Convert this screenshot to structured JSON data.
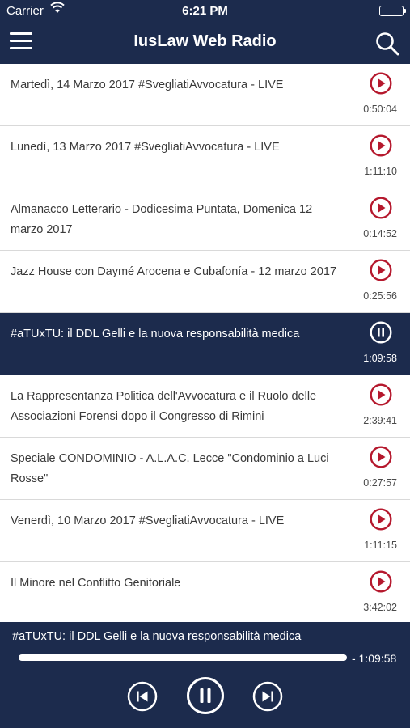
{
  "status": {
    "carrier": "Carrier",
    "time": "6:21 PM"
  },
  "nav": {
    "title": "IusLaw Web Radio"
  },
  "episodes": [
    {
      "title": "Martedì, 14 Marzo 2017 #SvegliatiAvvocatura - LIVE",
      "duration": "0:50:04"
    },
    {
      "title": "Lunedì, 13 Marzo 2017 #SvegliatiAvvocatura - LIVE",
      "duration": "1:11:10"
    },
    {
      "title": "Almanacco Letterario - Dodicesima Puntata, Domenica 12 marzo 2017",
      "duration": "0:14:52"
    },
    {
      "title": "Jazz House con Daymé Arocena e Cubafonía - 12 marzo 2017",
      "duration": "0:25:56"
    },
    {
      "title": "#aTUxTU: il DDL Gelli e la nuova responsabilità medica",
      "duration": "1:09:58",
      "playing": true
    },
    {
      "title": "La Rappresentanza Politica dell'Avvocatura e il Ruolo delle Associazioni Forensi dopo il Congresso di Rimini",
      "duration": "2:39:41"
    },
    {
      "title": "Speciale CONDOMINIO - A.L.A.C. Lecce \"Condominio a Luci Rosse\"",
      "duration": "0:27:57"
    },
    {
      "title": "Venerdì, 10 Marzo 2017 #SvegliatiAvvocatura - LIVE",
      "duration": "1:11:15"
    },
    {
      "title": "Il Minore nel Conflitto Genitoriale",
      "duration": "3:42:02"
    }
  ],
  "player": {
    "now_playing": "#aTUxTU: il DDL Gelli e la nuova responsabilità medica",
    "remaining": "- 1:09:58",
    "progress": 1.0
  },
  "colors": {
    "primary": "#1c2b4d",
    "accent": "#b5182d",
    "battery": "#3ddc4c"
  },
  "icons": {
    "menu": "hamburger-icon",
    "search": "search-icon",
    "play": "play-circle-icon",
    "pause": "pause-circle-icon",
    "prev": "skip-previous-icon",
    "next": "skip-next-icon"
  }
}
